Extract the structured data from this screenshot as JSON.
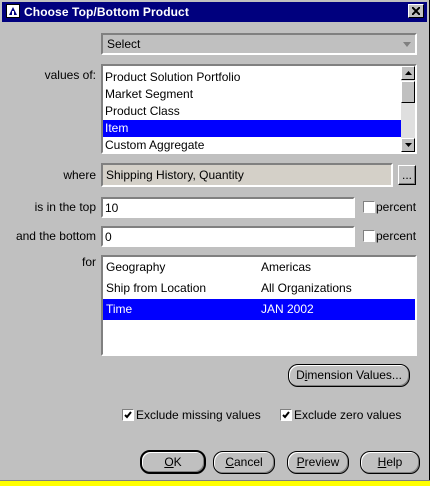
{
  "window": {
    "title": "Choose Top/Bottom Product"
  },
  "select": {
    "value": "Select"
  },
  "labels": {
    "values_of": "values of:",
    "where": "where",
    "top": "is in the top",
    "bottom": "and the bottom",
    "for": "for"
  },
  "values_list": {
    "items": [
      "Product Solution Portfolio",
      "Market Segment",
      "Product Class",
      "Item",
      "Custom Aggregate"
    ],
    "selected_index": 3
  },
  "where": {
    "value": "Shipping History, Quantity",
    "browse_label": "..."
  },
  "top": {
    "value": "10",
    "percent_label": "percent"
  },
  "bottom": {
    "value": "0",
    "percent_label": "percent"
  },
  "for_table": {
    "rows": [
      {
        "dimension": "Geography",
        "value": "Americas"
      },
      {
        "dimension": "Ship from Location",
        "value": "All Organizations"
      },
      {
        "dimension": "Time",
        "value": "JAN 2002"
      }
    ],
    "selected_index": 2
  },
  "buttons": {
    "dimension_values_pre": "D",
    "dimension_values_ul": "i",
    "dimension_values_post": "mension Values...",
    "ok_ul": "O",
    "ok_post": "K",
    "cancel_ul": "C",
    "cancel_post": "ancel",
    "preview_ul": "P",
    "preview_post": "review",
    "help_ul": "H",
    "help_post": "elp"
  },
  "checks": {
    "exclude_missing": {
      "label": "Exclude missing values",
      "checked": true
    },
    "exclude_zero": {
      "label": "Exclude zero values",
      "checked": true
    }
  },
  "colors": {
    "titlebar": "#00007e",
    "selection": "#0000ff",
    "dialog": "#c0c0c0",
    "statusbar": "#ffff00"
  }
}
